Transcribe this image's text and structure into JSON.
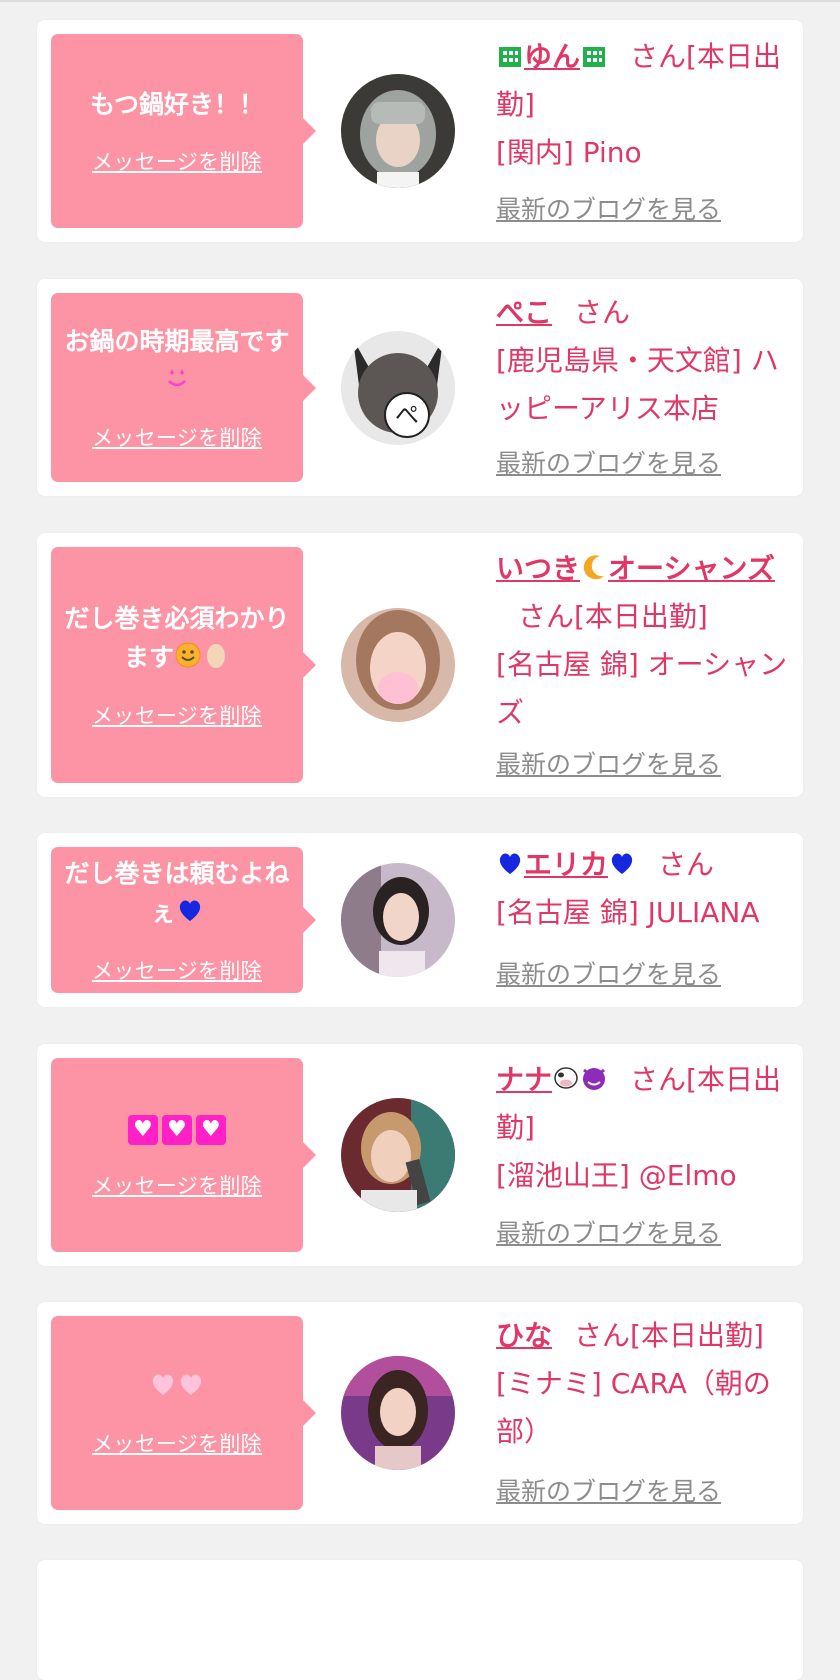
{
  "colors": {
    "background": "#f1f1f1",
    "bubble": "#fd94a6",
    "name_link": "#e03866",
    "blog_link": "#8c8c8c"
  },
  "cards": [
    {
      "message": "もつ鍋好き！！",
      "delete_label": "メッセージを削除",
      "name": "ゆん",
      "name_prefix_icon": "building-icon",
      "name_suffix_icon": "building-icon",
      "honorific": "さん[本日出勤]",
      "shop": "[関内] Pino",
      "blog_label": "最新のブログを見る"
    },
    {
      "message": "お鍋の時期最高です",
      "message_icon": "star-struck-face-icon",
      "delete_label": "メッセージを削除",
      "name": "ぺこ",
      "honorific": "さん",
      "shop": "[鹿児島県・天文館] ハッピーアリス本店",
      "blog_label": "最新のブログを見る"
    },
    {
      "message": "だし巻き必須わかります",
      "message_icons": [
        "smiley-face-icon",
        "egg-icon"
      ],
      "delete_label": "メッセージを削除",
      "name": "いつき",
      "name_mid_icon": "crescent-moon-icon",
      "name_tail": "オーシャンズ",
      "honorific": "さん[本日出勤]",
      "shop": "[名古屋 錦] オーシャンズ",
      "blog_label": "最新のブログを見る"
    },
    {
      "message": "だし巻きは頼むよねぇ",
      "message_icon": "blue-heart-icon",
      "delete_label": "メッセージを削除",
      "name": "エリカ",
      "name_prefix_icon": "blue-heart-icon",
      "name_suffix_icon": "blue-heart-icon",
      "honorific": "さん",
      "shop": "[名古屋 錦] JULIANA",
      "blog_label": "最新のブログを見る"
    },
    {
      "message": "",
      "message_icons": [
        "heart-box-icon",
        "heart-box-icon",
        "heart-box-icon"
      ],
      "delete_label": "メッセージを削除",
      "name": "ナナ",
      "name_suffix_icons": [
        "cow-icon",
        "purple-devil-icon"
      ],
      "honorific": "さん[本日出勤]",
      "shop": "[溜池山王] @Elmo",
      "blog_label": "最新のブログを見る"
    },
    {
      "message": "",
      "message_icons": [
        "pink-heart-icon",
        "pink-heart-icon"
      ],
      "delete_label": "メッセージを削除",
      "name": "ひな",
      "honorific": "さん[本日出勤]",
      "shop": "[ミナミ] CARA（朝の部）",
      "blog_label": "最新のブログを見る"
    }
  ]
}
